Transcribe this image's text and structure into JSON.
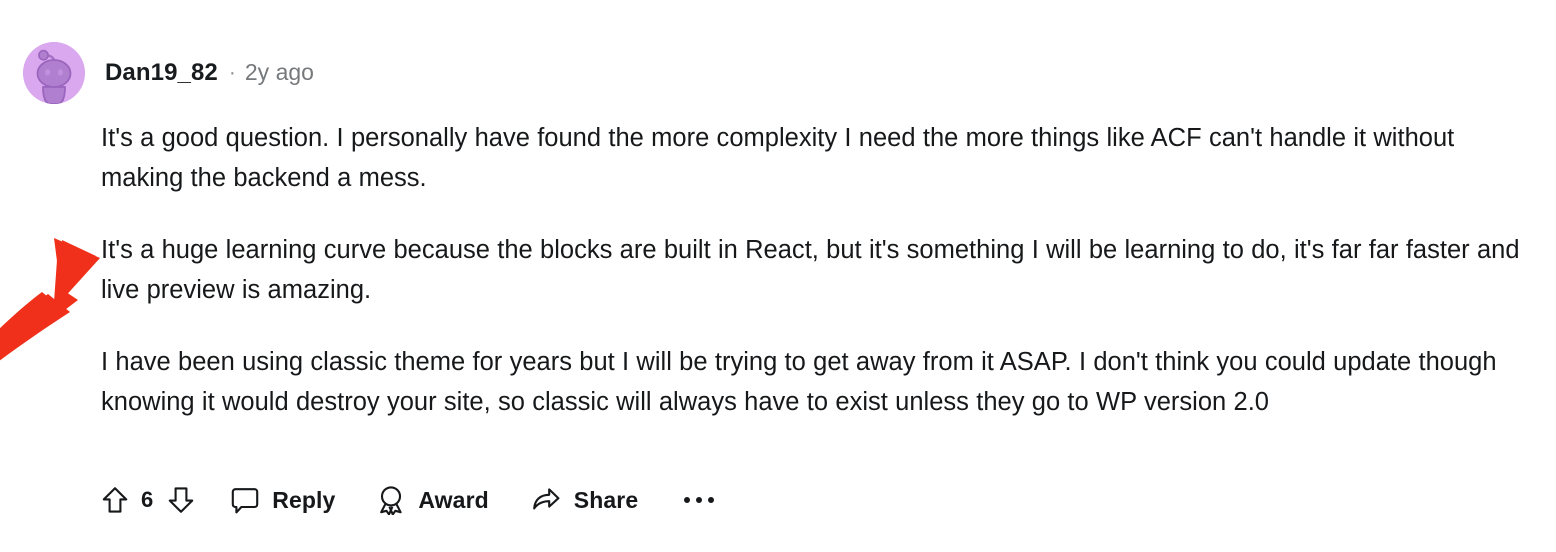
{
  "comment": {
    "author": "Dan19_82",
    "separator": "·",
    "timestamp": "2y ago",
    "avatar_icon": "snoo-avatar-icon",
    "avatar_bg_color": "#d9a8ef",
    "avatar_figure_color": "#a06cc4",
    "paragraphs": [
      "It's a good question. I personally have found the more complexity I need the more things like ACF can't handle it without making the backend a mess.",
      "It's a huge learning curve because the blocks are built in React, but it's something I will be learning to do, it's far far faster and live preview is amazing.",
      "I have been using classic theme for years but I will be trying to get away from it ASAP. I don't think you could update though knowing it would destroy your site, so classic will always have to exist unless they go to WP version 2.0"
    ]
  },
  "actions": {
    "upvote_icon": "upvote-arrow-icon",
    "downvote_icon": "downvote-arrow-icon",
    "vote_count": "6",
    "reply_icon": "comment-bubble-icon",
    "reply_label": "Reply",
    "award_icon": "award-medal-icon",
    "award_label": "Award",
    "share_icon": "share-arrow-icon",
    "share_label": "Share",
    "overflow_icon": "more-options-icon"
  },
  "annotation": {
    "arrow_icon": "red-curved-arrow-icon",
    "arrow_color": "#f0301a"
  }
}
